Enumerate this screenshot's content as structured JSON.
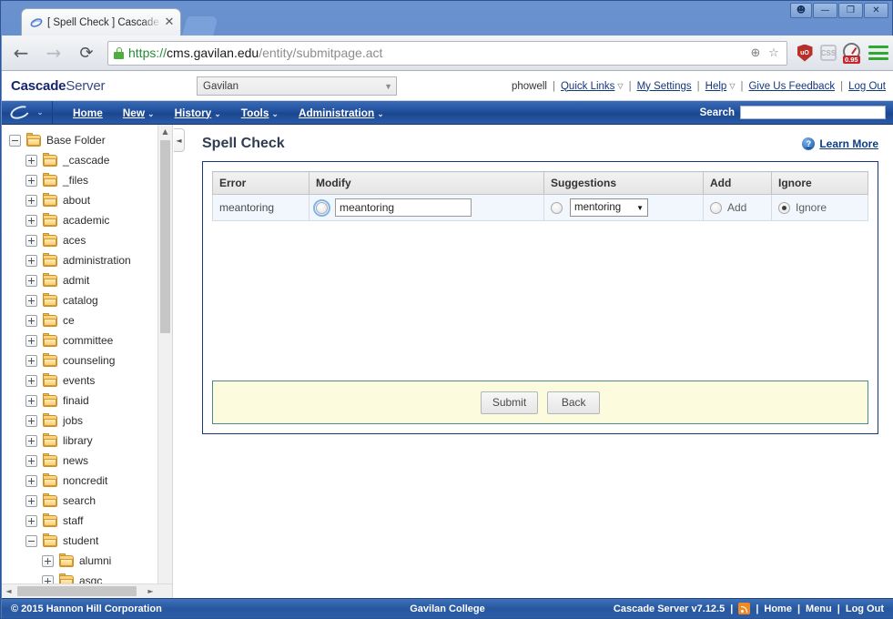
{
  "browser": {
    "tab_title": "[ Spell Check ] Cascade Ser",
    "tab_close": "✕",
    "back_icon": "←",
    "forward_icon": "→",
    "reload_icon": "⟳",
    "url_scheme": "https://",
    "url_host": "cms.gavilan.edu",
    "url_path": "/entity/submitpage.act",
    "zoom_icon": "⊕",
    "bookmark_icon": "☆",
    "extensions": [
      {
        "name": "ublock-origin-icon",
        "label": "uO"
      },
      {
        "name": "css-icon",
        "label": "CSS"
      },
      {
        "name": "page-speed-icon",
        "label": "0.95"
      }
    ],
    "window_controls": {
      "user": "☻",
      "minimize": "—",
      "maximize": "❐",
      "close": "✕"
    }
  },
  "app": {
    "brand_bold": "Cascade",
    "brand_light": "Server",
    "site_select": {
      "value": "Gavilan",
      "caret": "▼"
    },
    "userbar": {
      "username": "phowell",
      "quick_links": "Quick Links",
      "my_settings": "My Settings",
      "help": "Help",
      "feedback": "Give Us Feedback",
      "logout": "Log Out",
      "separator": "|",
      "dropdown_caret": "▽"
    },
    "nav": {
      "items": [
        {
          "label": "Home",
          "has_caret": false
        },
        {
          "label": "New",
          "has_caret": true
        },
        {
          "label": "History",
          "has_caret": true
        },
        {
          "label": "Tools",
          "has_caret": true
        },
        {
          "label": "Administration",
          "has_caret": true
        }
      ],
      "caret": "⌄",
      "logo_caret": "⌄",
      "search_label": "Search",
      "search_value": "",
      "search_placeholder": ""
    }
  },
  "tree": {
    "nodes": [
      {
        "label": "Base Folder",
        "depth": 0,
        "expanded": true
      },
      {
        "label": "_cascade",
        "depth": 1,
        "expanded": false
      },
      {
        "label": "_files",
        "depth": 1,
        "expanded": false
      },
      {
        "label": "about",
        "depth": 1,
        "expanded": false
      },
      {
        "label": "academic",
        "depth": 1,
        "expanded": false
      },
      {
        "label": "aces",
        "depth": 1,
        "expanded": false
      },
      {
        "label": "administration",
        "depth": 1,
        "expanded": false
      },
      {
        "label": "admit",
        "depth": 1,
        "expanded": false
      },
      {
        "label": "catalog",
        "depth": 1,
        "expanded": false
      },
      {
        "label": "ce",
        "depth": 1,
        "expanded": false
      },
      {
        "label": "committee",
        "depth": 1,
        "expanded": false
      },
      {
        "label": "counseling",
        "depth": 1,
        "expanded": false
      },
      {
        "label": "events",
        "depth": 1,
        "expanded": false
      },
      {
        "label": "finaid",
        "depth": 1,
        "expanded": false
      },
      {
        "label": "jobs",
        "depth": 1,
        "expanded": false
      },
      {
        "label": "library",
        "depth": 1,
        "expanded": false
      },
      {
        "label": "news",
        "depth": 1,
        "expanded": false
      },
      {
        "label": "noncredit",
        "depth": 1,
        "expanded": false
      },
      {
        "label": "search",
        "depth": 1,
        "expanded": false
      },
      {
        "label": "staff",
        "depth": 1,
        "expanded": false
      },
      {
        "label": "student",
        "depth": 1,
        "expanded": true
      },
      {
        "label": "alumni",
        "depth": 2,
        "expanded": false
      },
      {
        "label": "asgc",
        "depth": 2,
        "expanded": false
      }
    ],
    "scroll_up": "▲",
    "scroll_down": "▼",
    "scroll_left": "◄",
    "scroll_right": "►",
    "collapse_icon": "◄"
  },
  "page": {
    "title": "Spell Check",
    "learn_more": "Learn More",
    "help_icon_glyph": "?",
    "table": {
      "headers": [
        "Error",
        "Modify",
        "Suggestions",
        "Add",
        "Ignore"
      ],
      "rows": [
        {
          "error": "meantoring",
          "modify_selected": false,
          "modify_focused": true,
          "modify_value": "meantoring",
          "suggestion_selected": false,
          "suggestion_value": "mentoring",
          "suggestion_caret": "▼",
          "add_selected": false,
          "add_label": "Add",
          "ignore_selected": true,
          "ignore_label": "Ignore"
        }
      ]
    },
    "buttons": {
      "submit": "Submit",
      "back": "Back"
    }
  },
  "footer": {
    "copyright": "© 2015 Hannon Hill Corporation",
    "site_name": "Gavilan College",
    "version": "Cascade Server v7.12.5",
    "separator": "|",
    "home": "Home",
    "menu": "Menu",
    "logout": "Log Out"
  }
}
